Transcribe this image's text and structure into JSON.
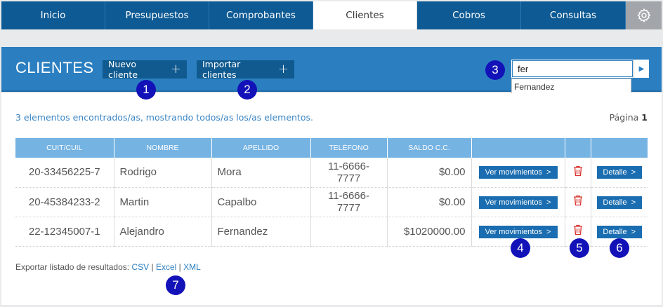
{
  "nav": {
    "tabs": [
      {
        "label": "Inicio"
      },
      {
        "label": "Presupuestos"
      },
      {
        "label": "Comprobantes"
      },
      {
        "label": "Clientes"
      },
      {
        "label": "Cobros"
      },
      {
        "label": "Consultas"
      }
    ],
    "active": "Clientes",
    "settings_icon": "gear-icon"
  },
  "header": {
    "title": "CLIENTES",
    "new_client_label": "Nuevo cliente",
    "import_clients_label": "Importar clientes",
    "search_value": "fer",
    "search_suggestion": "Fernandez"
  },
  "results": {
    "info": "3 elementos encontrados/as, mostrando todos/as los/as elementos.",
    "page_label": "Página",
    "page_number": "1"
  },
  "table": {
    "columns": [
      "CUIT/CUIL",
      "NOMBRE",
      "APELLIDO",
      "TELÉFONO",
      "SALDO C.C."
    ],
    "rows": [
      {
        "cuit": "20-33456225-7",
        "nombre": "Rodrigo",
        "apellido": "Mora",
        "telefono": "11-6666-7777",
        "saldo": "$0.00"
      },
      {
        "cuit": "20-45384233-2",
        "nombre": "Martin",
        "apellido": "Capalbo",
        "telefono": "11-6666-7777",
        "saldo": "$0.00"
      },
      {
        "cuit": "22-12345007-1",
        "nombre": "Alejandro",
        "apellido": "Fernandez",
        "telefono": "",
        "saldo": "$1020000.00"
      }
    ],
    "movements_label": "Ver movimientos",
    "detail_label": "Detalle"
  },
  "export": {
    "label": "Exportar listado de resultados:",
    "csv": "CSV",
    "excel": "Excel",
    "xml": "XML",
    "separator": "|"
  },
  "markers": [
    "1",
    "2",
    "3",
    "4",
    "5",
    "6",
    "7"
  ],
  "colors": {
    "nav_bg": "#0e5a94",
    "header_bg": "#2b7fc1",
    "table_header": "#75b3e3",
    "button": "#1a6db0",
    "trash": "#d9302b",
    "marker": "#1212b8"
  }
}
